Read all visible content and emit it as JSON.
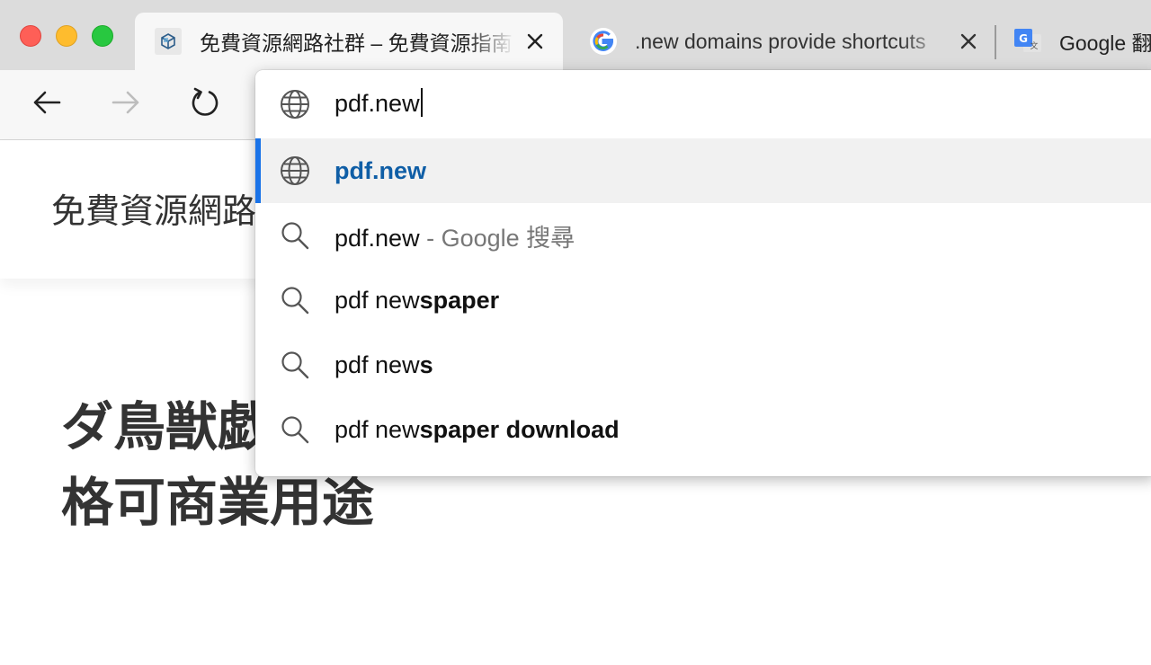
{
  "tabs": [
    {
      "title": "免費資源網路社群 – 免費資源指南",
      "favicon": "cube-icon"
    },
    {
      "title": ".new domains provide shortcuts",
      "favicon": "google-g-icon"
    },
    {
      "title": "Google 翻譯",
      "favicon": "google-translate-icon"
    }
  ],
  "toolbar": {
    "back": "arrow-left-icon",
    "forward": "arrow-right-icon",
    "reload": "reload-icon"
  },
  "page": {
    "site_name": "免費資源網路社群",
    "headline_line1": "ダ鳥獣戯",
    "headline_line2": "格可商業用途"
  },
  "omnibox": {
    "input_value": "pdf.new",
    "suggestions": [
      {
        "type": "url",
        "icon": "globe-icon",
        "prefix": "pdf.new",
        "bold": "",
        "suffix": ""
      },
      {
        "type": "search",
        "icon": "search-icon",
        "prefix": "pdf.new",
        "bold": "",
        "suffix": " - Google 搜尋"
      },
      {
        "type": "search",
        "icon": "search-icon",
        "prefix": "pdf new",
        "bold": "spaper",
        "suffix": ""
      },
      {
        "type": "search",
        "icon": "search-icon",
        "prefix": "pdf new",
        "bold": "s",
        "suffix": ""
      },
      {
        "type": "search",
        "icon": "search-icon",
        "prefix": "pdf new",
        "bold": "spaper download",
        "suffix": ""
      }
    ]
  },
  "colors": {
    "selected_accent": "#1a73e8",
    "url_text": "#0f5ea6"
  }
}
